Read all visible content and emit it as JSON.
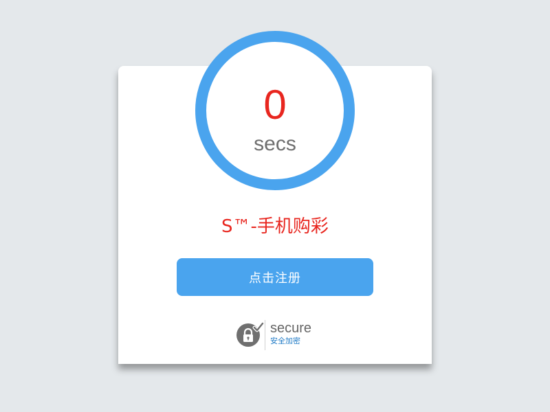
{
  "countdown": {
    "value": "0",
    "unit": "secs"
  },
  "title": "S™-手机购彩",
  "register_button": {
    "label": "点击注册"
  },
  "secure_badge": {
    "word": "secure",
    "subtitle": "安全加密",
    "icon": "padlock-check-icon"
  },
  "colors": {
    "accent": "#4aa4ee",
    "alert": "#e8261f",
    "background": "#e4e8eb"
  }
}
